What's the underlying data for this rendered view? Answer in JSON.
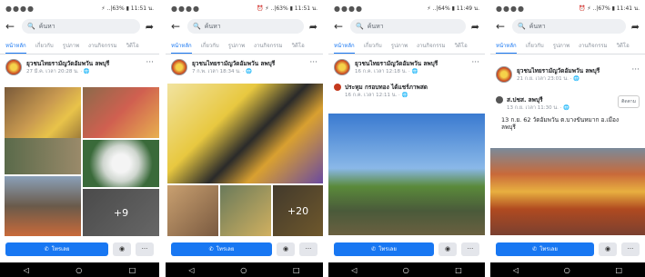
{
  "phones": [
    {
      "status_right": "⚡ ..|63% ▮ 11:51 น.",
      "search_placeholder": "ค้นหา",
      "tabs": [
        "หน้าหลัก",
        "เกี่ยวกับ",
        "รูปภาพ",
        "งานกิจกรรม",
        "วิดีโอ"
      ],
      "page_name": "ยุวชนไทยรามัญวัดอัมพวัน ลพบุรี",
      "post_time": "27 มี.ค. เวลา 20:28 น. · 🌐",
      "photo_more": "+9",
      "call_label": "โทรเลย"
    },
    {
      "status_right": "⏰ ⚡ ..|63% ▮ 11:51 น.",
      "search_placeholder": "ค้นหา",
      "tabs": [
        "หน้าหลัก",
        "เกี่ยวกับ",
        "รูปภาพ",
        "งานกิจกรรม",
        "วิดีโอ"
      ],
      "page_name": "ยุวชนไทยรามัญวัดอัมพวัน ลพบุรี",
      "post_time": "7 ก.พ. เวลา 18:34 น. · 🌐",
      "photo_more": "+20",
      "call_label": "โทรเลย"
    },
    {
      "status_right": "⚡ ..|64% ▮ 11:49 น.",
      "search_placeholder": "ค้นหา",
      "tabs": [
        "หน้าหลัก",
        "เกี่ยวกับ",
        "รูปภาพ",
        "งานกิจกรรม",
        "วิดีโอ"
      ],
      "page_name": "ยุวชนไทยรามัญวัดอัมพวัน ลพบุรี",
      "post_time": "16 ก.ค. เวลา 12:18 น. · 🌐",
      "event_title": "ประหุม กรอบทอง ได้แชร์ภาพสด",
      "event_time": "16 ก.ค. เวลา 12:11 น. · 🌐",
      "call_label": "โทรเลย"
    },
    {
      "status_right": "⏰ ⚡ ..|67% ▮ 11:41 น.",
      "search_placeholder": "ค้นหา",
      "tabs": [
        "หน้าหลัก",
        "เกี่ยวกับ",
        "รูปภาพ",
        "งานกิจกรรม",
        "วิดีโอ"
      ],
      "page_name": "ยุวชนไทยรามัญวัดอัมพวัน ลพบุรี",
      "post_time": "21 ก.ย. เวลา 23:01 น. · 🌐",
      "event_title": "ส.ปชส. ลพบุรี",
      "event_time": "13 ก.ย. เวลา 11:30 น. · 🌐",
      "save_label": "ติดตาม",
      "message": "13 ก.ย. 62 วัดอัมพวัน ต.บางขันหมาก อ.เมือง ลพบุรี",
      "call_label": "โทรเลย"
    }
  ],
  "nav": {
    "back": "◁",
    "home": "○",
    "recent": "□"
  },
  "icons": {
    "more": "···",
    "messenger": "◉",
    "phone": "📞"
  }
}
